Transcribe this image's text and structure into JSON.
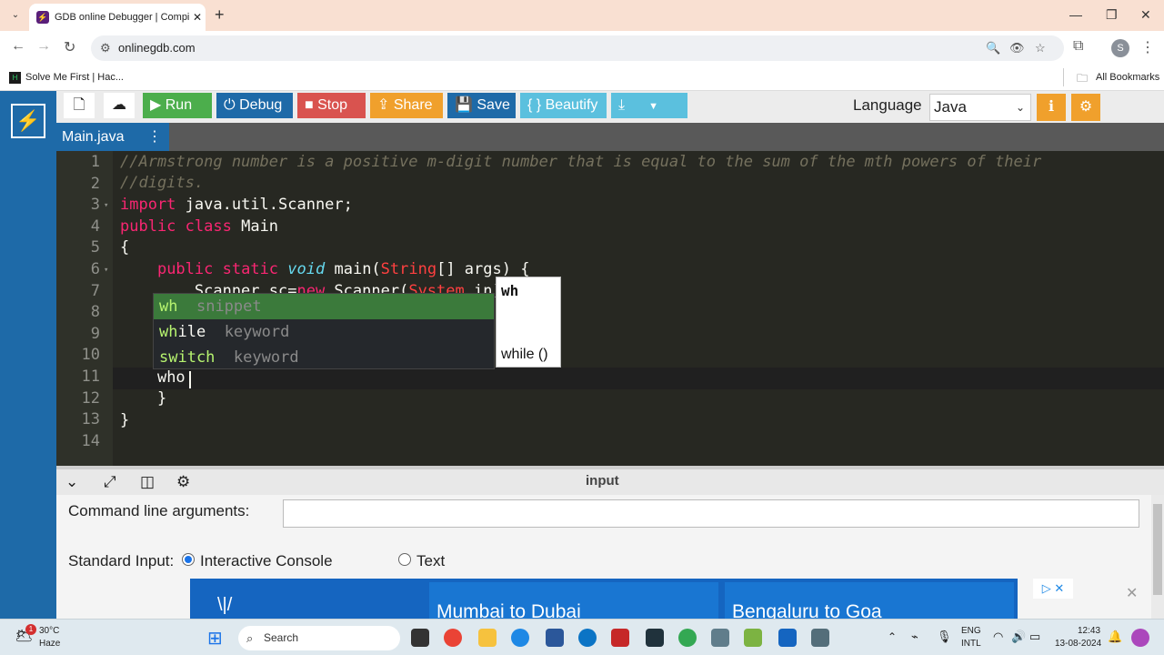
{
  "browser": {
    "tab_title": "GDB online Debugger | Compi",
    "url": "onlinegdb.com",
    "bookmark": "Solve Me First | Hac...",
    "all_bookmarks": "All Bookmarks",
    "profile_initial": "S"
  },
  "toolbar": {
    "run": "Run",
    "debug": "Debug",
    "stop": "Stop",
    "share": "Share",
    "save": "Save",
    "beautify": "{ } Beautify",
    "language_label": "Language",
    "language_value": "Java"
  },
  "file_tab": "Main.java",
  "editor": {
    "line_numbers": [
      "1",
      "2",
      "3",
      "4",
      "5",
      "6",
      "7",
      "8",
      "9",
      "10",
      "11",
      "12",
      "13",
      "14"
    ],
    "current_text": "who"
  },
  "autocomplete": {
    "items": [
      {
        "match": "wh",
        "rest": "",
        "meta": "snippet"
      },
      {
        "match": "wh",
        "rest": "ile",
        "meta": "keyword"
      },
      {
        "match": "switch",
        "rest": "",
        "meta": "keyword"
      }
    ],
    "doc_title": "wh",
    "doc_body": "while ()"
  },
  "input_panel": {
    "title": "input",
    "cmd_label": "Command line arguments:",
    "stdin_label": "Standard Input:",
    "option_console": "Interactive Console",
    "option_text": "Text"
  },
  "ad": {
    "card1": "Mumbai to Dubai",
    "card2": "Bengaluru to Goa"
  },
  "taskbar": {
    "temp": "30°C",
    "weather": "Haze",
    "search": "Search",
    "lang1": "ENG",
    "lang2": "INTL",
    "time": "12:43",
    "date": "13-08-2024",
    "notif_count": "1"
  },
  "colors": {
    "run": "#4cae4c",
    "debug": "#1e6aa8",
    "stop": "#d9534f",
    "share": "#f0a02c",
    "save": "#1e6aa8",
    "beautify": "#5bc0de",
    "sidebar": "#1e6aa8"
  }
}
